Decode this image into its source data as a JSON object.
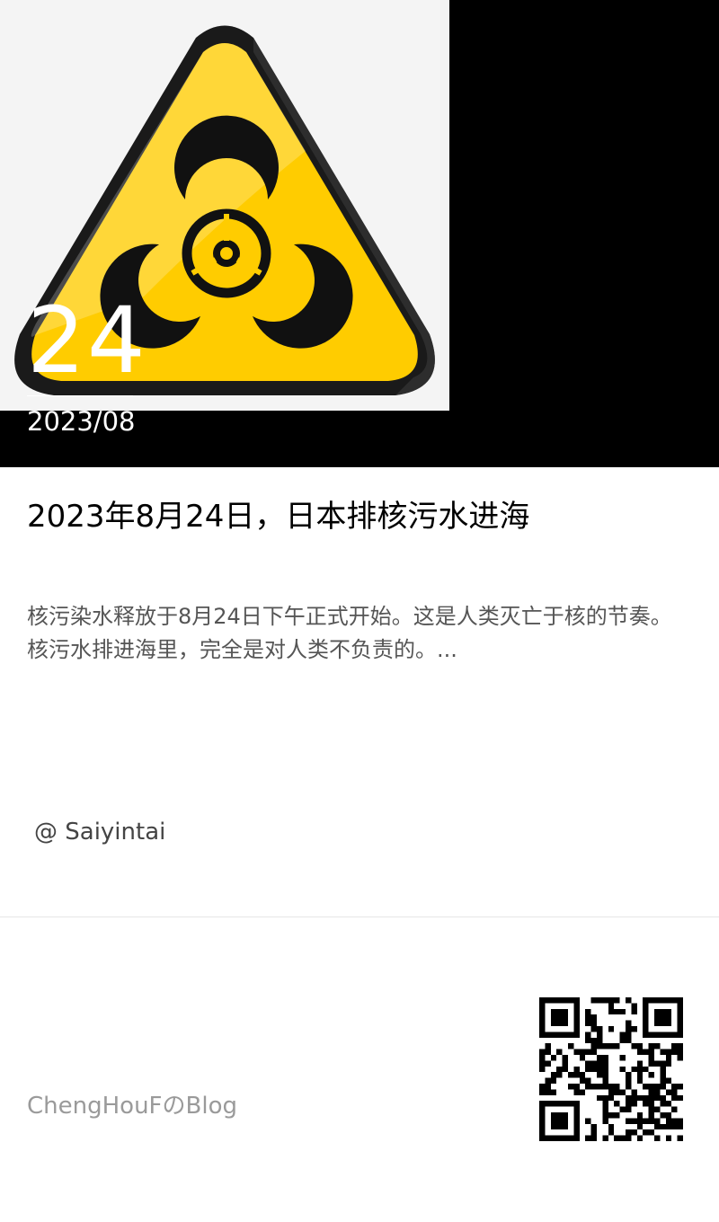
{
  "hero": {
    "image_icon": "biohazard-warning-icon",
    "day": "24",
    "month_year": "2023/08"
  },
  "article": {
    "title": "2023年8月24日，日本排核污水进海",
    "excerpt": "核污染水释放于8月24日下午正式开始。这是人类灭亡于核的节奏。核污水排进海里，完全是对人类不负责的。...",
    "author": "@ Saiyintai"
  },
  "footer": {
    "blog_name": "ChengHouFのBlog",
    "qr_icon": "qr-code-icon"
  },
  "colors": {
    "hero_background": "#000000",
    "warning_yellow": "#ffcc00",
    "title_text": "#000000",
    "excerpt_text": "#555555",
    "blog_name_text": "#9a9a9a"
  }
}
